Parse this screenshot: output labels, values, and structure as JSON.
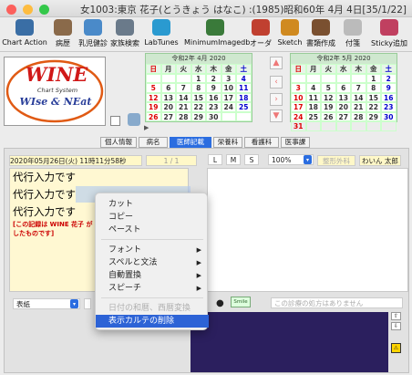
{
  "window": {
    "title": "女1003:東京 花子(とうきょう はなこ) :(1985)昭和60年 4月 4日[35/1/22]"
  },
  "toolbar": {
    "items": [
      {
        "label": "Chart Action",
        "icon": "chart-action-icon",
        "color": "#3a6ea5"
      },
      {
        "label": "病歴",
        "icon": "disease-history-icon",
        "color": "#8a6a4a"
      },
      {
        "label": "乳児健診",
        "icon": "infant-checkup-icon",
        "color": "#4a8ac9"
      },
      {
        "label": "家族検索",
        "icon": "family-search-icon",
        "color": "#6a7a8a"
      },
      {
        "label": "LabTunes",
        "icon": "labtunes-icon",
        "color": "#2a9ad0"
      },
      {
        "label": "MinimumImagedb",
        "icon": "imagedb-icon",
        "color": "#3a7a3a"
      },
      {
        "label": "オーダ",
        "icon": "order-icon",
        "color": "#c04030"
      },
      {
        "label": "Sketch",
        "icon": "sketch-icon",
        "color": "#d08a20"
      },
      {
        "label": "書類作成",
        "icon": "document-icon",
        "color": "#7a5030"
      },
      {
        "label": "付箋",
        "icon": "sticky-note-icon",
        "color": "#bbbbbb"
      },
      {
        "label": "Sticky追加",
        "icon": "sticky-add-icon",
        "color": "#c04060"
      }
    ]
  },
  "logo": {
    "title": "WINE",
    "subtitle": "Chart System",
    "tagline": "WIse & NEat"
  },
  "calendars": [
    {
      "header": "令和2年 4月 2020",
      "weekdays": [
        "日",
        "月",
        "火",
        "水",
        "木",
        "金",
        "土"
      ],
      "days": [
        "",
        "",
        "",
        "1",
        "2",
        "3",
        "4",
        "5",
        "6",
        "7",
        "8",
        "9",
        "10",
        "11",
        "12",
        "13",
        "14",
        "15",
        "16",
        "17",
        "18",
        "19",
        "20",
        "21",
        "22",
        "23",
        "24",
        "25",
        "26",
        "27",
        "28",
        "29",
        "30",
        "",
        ""
      ]
    },
    {
      "header": "令和2年 5月 2020",
      "weekdays": [
        "日",
        "月",
        "火",
        "水",
        "木",
        "金",
        "土"
      ],
      "days": [
        "",
        "",
        "",
        "",
        "",
        "1",
        "2",
        "3",
        "4",
        "5",
        "6",
        "7",
        "8",
        "9",
        "10",
        "11",
        "12",
        "13",
        "14",
        "15",
        "16",
        "17",
        "18",
        "19",
        "20",
        "21",
        "22",
        "23",
        "24",
        "25",
        "26",
        "27",
        "28",
        "29",
        "30",
        "31",
        "",
        "",
        "",
        "",
        "",
        ""
      ]
    }
  ],
  "calendar_nav": {
    "prev": "‹",
    "next": "›",
    "up": "▲",
    "down": "▼"
  },
  "tabs": [
    "個人情報",
    "病名",
    "医師記載",
    "栄養科",
    "看護科",
    "医事課"
  ],
  "active_tab": "医師記載",
  "record": {
    "datetime": "2020年05月26日(火) 11時11分58秒",
    "page": "1 / 1",
    "size_l": "L",
    "size_m": "M",
    "size_s": "S",
    "zoom": "100%",
    "department_placeholder": "整形外科",
    "doctor": "わいん 太郎"
  },
  "editor": {
    "lines": [
      "代行入力です",
      "代行入力です",
      "代行入力です"
    ],
    "note": "[この記録は WINE 花子 が わ",
    "note2": "したものです]"
  },
  "context_menu": {
    "items": [
      {
        "label": "カット",
        "submenu": false,
        "disabled": false
      },
      {
        "label": "コピー",
        "submenu": false,
        "disabled": false
      },
      {
        "label": "ペースト",
        "submenu": false,
        "disabled": false
      },
      {
        "label": "フォント",
        "submenu": true,
        "disabled": false
      },
      {
        "label": "スペルと文法",
        "submenu": true,
        "disabled": false
      },
      {
        "label": "自動置換",
        "submenu": true,
        "disabled": false
      },
      {
        "label": "スピーチ",
        "submenu": true,
        "disabled": false
      },
      {
        "label": "日付の和暦、西暦変換",
        "submenu": false,
        "disabled": true
      },
      {
        "label": "表示カルテの削除",
        "submenu": false,
        "disabled": false,
        "selected": true
      }
    ]
  },
  "bottom": {
    "select_left": "表紙",
    "prescription_placeholder": "この診療の処方はありません",
    "smile_label": "Smile"
  }
}
